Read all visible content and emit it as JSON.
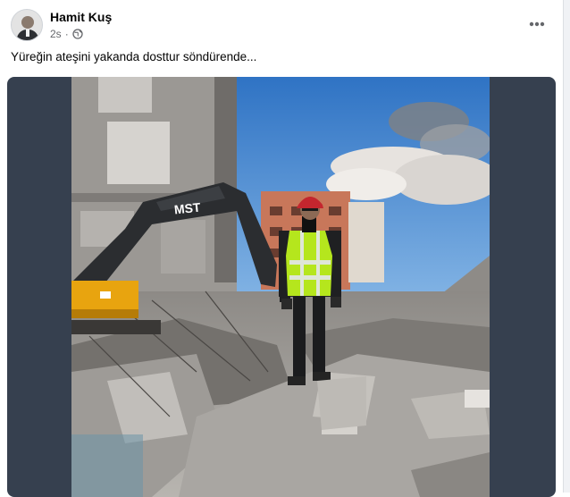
{
  "post": {
    "author": "Hamit Kuş",
    "time": "2s",
    "visibility_icon": "globe-icon",
    "more_icon": "more-horizontal-icon",
    "caption": "Yüreğin ateşini yakanda dosttur söndürende...",
    "photo": {
      "excavator_brand": "MST",
      "colors": {
        "sky": "#3d7fc9",
        "frame": "#36404f",
        "vest": "#b5e61d",
        "helmet": "#c4262e",
        "excavator": "#e8a40f"
      }
    }
  }
}
